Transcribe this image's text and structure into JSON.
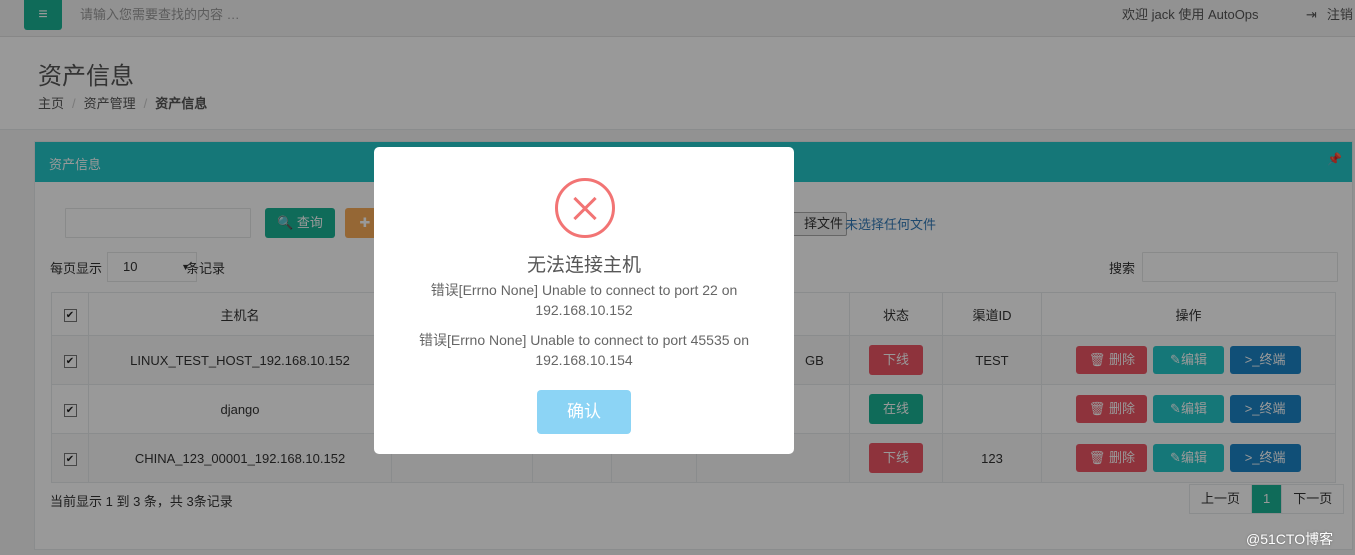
{
  "topbar": {
    "menu_icon": "menu-icon",
    "search_placeholder": "请输入您需要查找的内容 …",
    "welcome": "欢迎 jack 使用 AutoOps",
    "logout": "注销"
  },
  "page": {
    "title": "资产信息",
    "breadcrumb": [
      "主页",
      "资产管理",
      "资产信息"
    ]
  },
  "panel": {
    "title": "资产信息",
    "query_button": "查询",
    "choose_file": "择文件",
    "no_file": "未选择任何文件",
    "per_page_prefix": "每页显示",
    "per_page_value": "10",
    "per_page_suffix": "条记录",
    "search_label": "搜索"
  },
  "table": {
    "headers": [
      "主机名",
      "状态",
      "渠道ID",
      "操作"
    ],
    "rows": [
      {
        "host": "LINUX_TEST_HOST_192.168.10.152",
        "mem": "GB",
        "status": "下线",
        "channel": "TEST"
      },
      {
        "host": "django",
        "mem": "",
        "status": "在线",
        "channel": ""
      },
      {
        "host": "CHINA_123_00001_192.168.10.152",
        "mem": "",
        "status": "下线",
        "channel": "123"
      }
    ],
    "actions": {
      "delete": "删除",
      "edit": "编辑",
      "terminal": "终端"
    }
  },
  "footer": {
    "info": "当前显示 1 到 3 条，共 3条记录",
    "prev": "上一页",
    "current": "1",
    "next": "下一页"
  },
  "modal": {
    "title": "无法连接主机",
    "msg1": "错误[Errno None] Unable to connect to port 22 on 192.168.10.152",
    "msg2": "错误[Errno None] Unable to connect to port 45535 on 192.168.10.154",
    "ok": "确认"
  },
  "watermark": "@51CTO博客",
  "colors": {
    "primary": "#1ab394",
    "info": "#23c6c8",
    "danger": "#ed5565",
    "success_btn": "#1c84c6",
    "confirm": "#8cd4f5"
  }
}
